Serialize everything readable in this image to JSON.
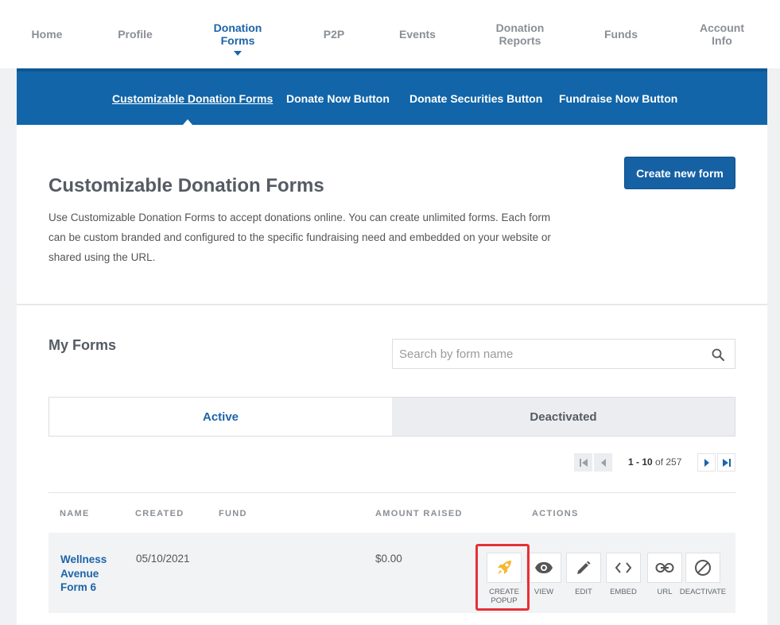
{
  "topnav": {
    "items": [
      {
        "label": "Home"
      },
      {
        "label": "Profile"
      },
      {
        "label_line1": "Donation",
        "label_line2": "Forms"
      },
      {
        "label": "P2P"
      },
      {
        "label": "Events"
      },
      {
        "label_line1": "Donation",
        "label_line2": "Reports"
      },
      {
        "label": "Funds"
      },
      {
        "label_line1": "Account",
        "label_line2": "Info"
      }
    ]
  },
  "subnav": {
    "items": [
      {
        "label": "Customizable Donation Forms"
      },
      {
        "label": "Donate Now Button"
      },
      {
        "label": "Donate Securities Button"
      },
      {
        "label": "Fundraise Now Button"
      }
    ]
  },
  "header": {
    "title": "Customizable Donation Forms",
    "description": "Use Customizable Donation Forms to accept donations online. You can create unlimited forms. Each form can be custom branded and configured to the specific fundraising need and embedded on your website or shared using the URL.",
    "create_button": "Create new form"
  },
  "forms": {
    "heading": "My Forms",
    "search_placeholder": "Search by form name",
    "tabs": [
      {
        "label": "Active"
      },
      {
        "label": "Deactivated"
      }
    ],
    "pagination": {
      "range": "1 - 10",
      "of_text": "of 257"
    },
    "columns": [
      "NAME",
      "CREATED",
      "FUND",
      "AMOUNT RAISED",
      "ACTIONS"
    ],
    "rows": [
      {
        "name": "Wellness Avenue Form 6",
        "created": "05/10/2021",
        "fund": "",
        "amount": "$0.00"
      }
    ],
    "actions": [
      {
        "label_line1": "CREATE",
        "label_line2": "POPUP",
        "icon": "rocket-icon"
      },
      {
        "label": "VIEW",
        "icon": "eye-icon"
      },
      {
        "label": "EDIT",
        "icon": "pencil-icon"
      },
      {
        "label": "EMBED",
        "icon": "code-icon"
      },
      {
        "label": "URL",
        "icon": "link-icon"
      },
      {
        "label": "DEACTIVATE",
        "icon": "block-icon"
      }
    ]
  },
  "colors": {
    "brand": "#1165a8",
    "highlight": "#e53136",
    "rocket": "#f5b82e"
  }
}
